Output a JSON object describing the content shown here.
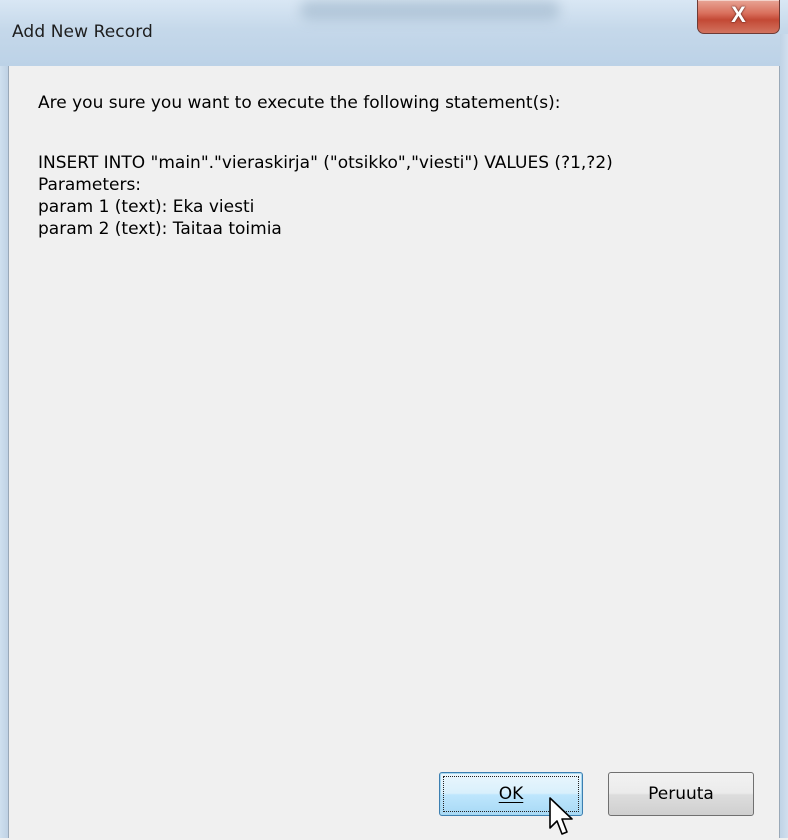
{
  "window": {
    "title": "Add New Record",
    "close_glyph": "X"
  },
  "dialog": {
    "question": "Are you sure you want to execute the following statement(s):",
    "statement_lines": [
      "INSERT INTO \"main\".\"vieraskirja\" (\"otsikko\",\"viesti\") VALUES (?1,?2)",
      "Parameters:",
      "param 1 (text): Eka viesti",
      "param 2 (text): Taitaa toimia"
    ]
  },
  "buttons": {
    "ok_label": "OK",
    "cancel_label": "Peruuta"
  },
  "icons": {
    "close": "close-icon",
    "cursor": "mouse-pointer-icon"
  },
  "colors": {
    "titlebar": "#c5d8ea",
    "close_button": "#c34935",
    "client_background": "#f0f0f0",
    "ok_button_focus": "#3c7fb1"
  }
}
